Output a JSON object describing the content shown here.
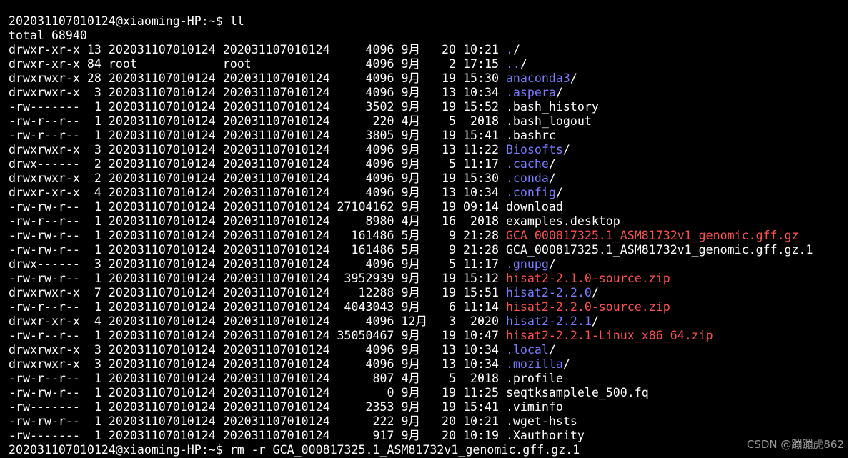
{
  "terminal": {
    "prompt_line": "202031107010124@xiaoming-HP:~$ ll",
    "total_line": "total 68940",
    "entries": [
      {
        "meta": "drwxr-xr-x 13 202031107010124 202031107010124     4096 9月   20 10:21 ",
        "name": "./",
        "type": "dir"
      },
      {
        "meta": "drwxr-xr-x 84 root            root                4096 9月    2 17:15 ",
        "name": "../",
        "type": "dir"
      },
      {
        "meta": "drwxrwxr-x 28 202031107010124 202031107010124     4096 9月   19 15:30 ",
        "name": "anaconda3/",
        "type": "dir"
      },
      {
        "meta": "drwxrwxr-x  3 202031107010124 202031107010124     4096 9月   13 10:34 ",
        "name": ".aspera/",
        "type": "dir"
      },
      {
        "meta": "-rw-------  1 202031107010124 202031107010124     3502 9月   19 15:52 ",
        "name": ".bash_history",
        "type": "file"
      },
      {
        "meta": "-rw-r--r--  1 202031107010124 202031107010124      220 4月    5  2018 ",
        "name": ".bash_logout",
        "type": "file"
      },
      {
        "meta": "-rw-r--r--  1 202031107010124 202031107010124     3805 9月   19 15:41 ",
        "name": ".bashrc",
        "type": "file"
      },
      {
        "meta": "drwxrwxr-x  3 202031107010124 202031107010124     4096 9月   13 11:22 ",
        "name": "Biosofts/",
        "type": "dir"
      },
      {
        "meta": "drwx------  2 202031107010124 202031107010124     4096 9月    5 11:17 ",
        "name": ".cache/",
        "type": "dir"
      },
      {
        "meta": "drwxrwxr-x  2 202031107010124 202031107010124     4096 9月   19 15:30 ",
        "name": ".conda/",
        "type": "dir"
      },
      {
        "meta": "drwxr-xr-x  4 202031107010124 202031107010124     4096 9月   13 10:34 ",
        "name": ".config/",
        "type": "dir"
      },
      {
        "meta": "-rw-rw-r--  1 202031107010124 202031107010124 27104162 9月   19 09:14 ",
        "name": "download",
        "type": "file"
      },
      {
        "meta": "-rw-r--r--  1 202031107010124 202031107010124     8980 4月   16  2018 ",
        "name": "examples.desktop",
        "type": "file"
      },
      {
        "meta": "-rw-rw-r--  1 202031107010124 202031107010124   161486 5月    9 21:28 ",
        "name": "GCA_000817325.1_ASM81732v1_genomic.gff.gz",
        "type": "archive"
      },
      {
        "meta": "-rw-rw-r--  1 202031107010124 202031107010124   161486 5月    9 21:28 ",
        "name": "GCA_000817325.1_ASM81732v1_genomic.gff.gz.1",
        "type": "file"
      },
      {
        "meta": "drwx------  3 202031107010124 202031107010124     4096 9月    5 11:17 ",
        "name": ".gnupg/",
        "type": "dir"
      },
      {
        "meta": "-rw-rw-r--  1 202031107010124 202031107010124  3952939 9月   19 15:12 ",
        "name": "hisat2-2.1.0-source.zip",
        "type": "archive"
      },
      {
        "meta": "drwxrwxr-x  7 202031107010124 202031107010124    12288 9月   19 15:51 ",
        "name": "hisat2-2.2.0/",
        "type": "dir"
      },
      {
        "meta": "-rw-r--r--  1 202031107010124 202031107010124  4043043 9月    6 11:14 ",
        "name": "hisat2-2.2.0-source.zip",
        "type": "archive"
      },
      {
        "meta": "drwxr-xr-x  4 202031107010124 202031107010124     4096 12月   3  2020 ",
        "name": "hisat2-2.2.1/",
        "type": "dir"
      },
      {
        "meta": "-rw-r--r--  1 202031107010124 202031107010124 35050467 9月   19 10:47 ",
        "name": "hisat2-2.2.1-Linux_x86_64.zip",
        "type": "archive"
      },
      {
        "meta": "drwxrwxr-x  3 202031107010124 202031107010124     4096 9月   13 10:34 ",
        "name": ".local/",
        "type": "dir"
      },
      {
        "meta": "drwxrwxr-x  3 202031107010124 202031107010124     4096 9月   13 10:34 ",
        "name": ".mozilla/",
        "type": "dir"
      },
      {
        "meta": "-rw-r--r--  1 202031107010124 202031107010124      807 4月    5  2018 ",
        "name": ".profile",
        "type": "file"
      },
      {
        "meta": "-rw-rw-r--  1 202031107010124 202031107010124        0 9月   19 11:25 ",
        "name": "seqtksamplele_500.fq",
        "type": "file"
      },
      {
        "meta": "-rw-------  1 202031107010124 202031107010124     2353 9月   19 15:41 ",
        "name": ".viminfo",
        "type": "file"
      },
      {
        "meta": "-rw-rw-r--  1 202031107010124 202031107010124      222 9月   20 10:21 ",
        "name": ".wget-hsts",
        "type": "file"
      },
      {
        "meta": "-rw-------  1 202031107010124 202031107010124      917 9月   20 10:19 ",
        "name": ".Xauthority",
        "type": "file"
      }
    ],
    "last_prompt_line": "202031107010124@xiaoming-HP:~$ rm -r GCA_000817325.1_ASM81732v1_genomic.gff.gz.1",
    "colors": {
      "background": "#000000",
      "text": "#ffffff",
      "dir": "#7b7bff",
      "archive": "#ff5050"
    }
  },
  "watermark": {
    "text": "CSDN @蹦蹦虎862"
  }
}
